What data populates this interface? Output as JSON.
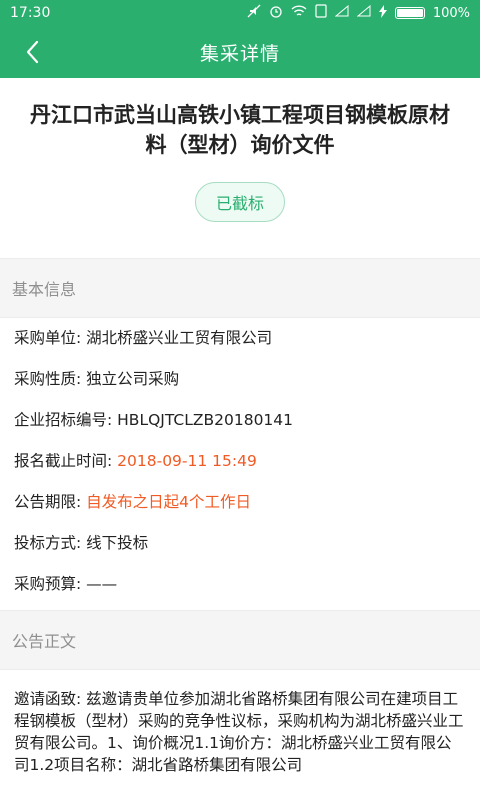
{
  "statusbar": {
    "time": "17:30",
    "battery_text": "100%",
    "battery_level": 1.0
  },
  "appbar": {
    "title": "集采详情"
  },
  "document": {
    "title": "丹江口市武当山高铁小镇工程项目钢模板原材料（型材）询价文件",
    "status_label": "已截标"
  },
  "basic": {
    "section_title": "基本信息",
    "unit_label": "采购单位: ",
    "unit_value": "湖北桥盛兴业工贸有限公司",
    "nature_label": "采购性质: ",
    "nature_value": "独立公司采购",
    "code_label": "企业招标编号: ",
    "code_value": "HBLQJTCLZB20180141",
    "deadline_label": "报名截止时间: ",
    "deadline_value": "2018-09-11 15:49",
    "period_label": "公告期限: ",
    "period_value": "自发布之日起4个工作日",
    "method_label": "投标方式: ",
    "method_value": "线下投标",
    "budget_label": "采购预算: ",
    "budget_value": "——"
  },
  "notice": {
    "section_title": "公告正文",
    "body": "邀请函致: 兹邀请贵单位参加湖北省路桥集团有限公司在建项目工程钢模板（型材）采购的竞争性议标，采购机构为湖北桥盛兴业工贸有限公司。1、询价概况1.1询价方：湖北桥盛兴业工贸有限公司1.2项目名称：湖北省路桥集团有限公司"
  },
  "colors": {
    "brand": "#2aaf6f",
    "highlight": "#f05a24"
  }
}
